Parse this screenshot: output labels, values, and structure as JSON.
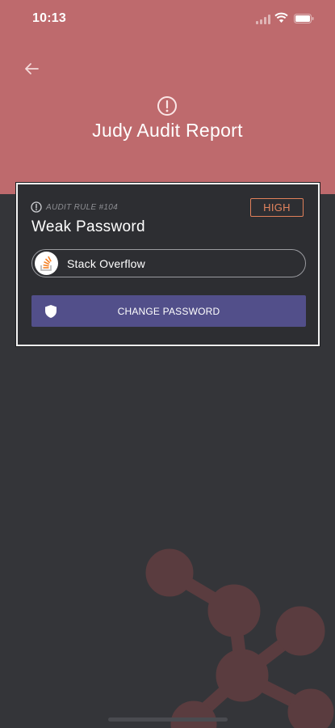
{
  "colors": {
    "header_bg": "#be6a6d",
    "page_bg": "#343539",
    "card_bg": "#2d2e32",
    "accent_severity": "#e3845e",
    "button_bg": "#524f8a",
    "decoration": "#5a3c3f"
  },
  "status_bar": {
    "time": "10:13",
    "icons": [
      "signal-icon",
      "wifi-icon",
      "battery-icon"
    ]
  },
  "header": {
    "back_icon": "arrow-left-icon",
    "alert_icon": "exclamation-circle-icon",
    "title": "Judy Audit Report"
  },
  "finding": {
    "rule_icon": "exclamation-circle-icon",
    "rule_label": "AUDIT RULE #104",
    "severity": "HIGH",
    "title": "Weak Password",
    "account": {
      "icon": "stack-overflow-logo",
      "name": "Stack Overflow"
    },
    "action": {
      "icon": "shield-icon",
      "label": "CHANGE PASSWORD"
    }
  }
}
